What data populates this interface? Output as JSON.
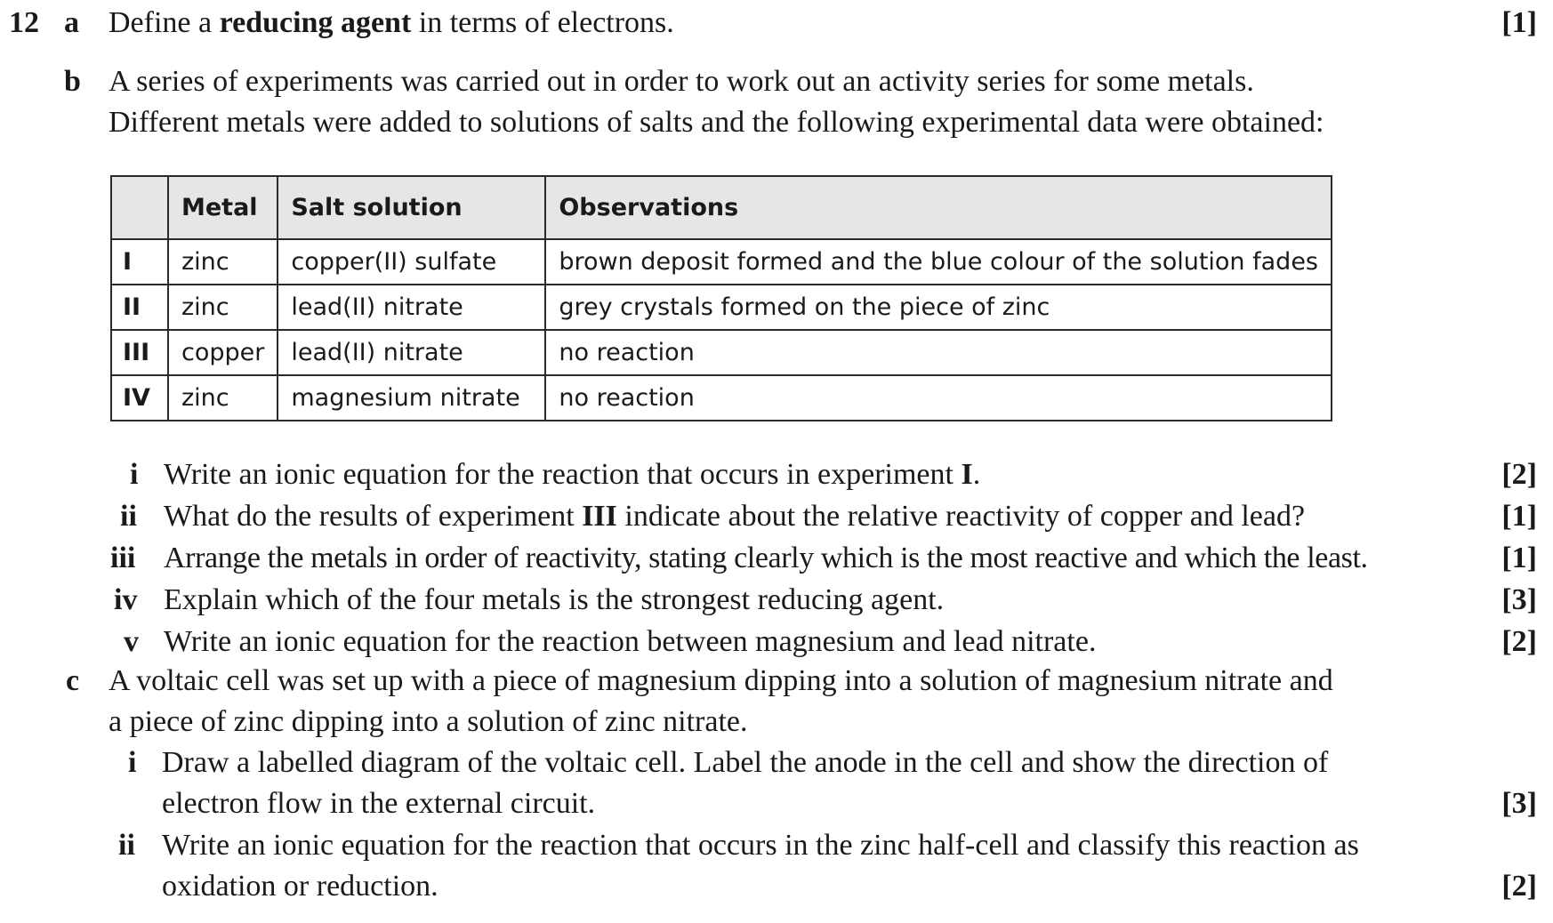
{
  "question": {
    "number": "12",
    "a": {
      "letter": "a",
      "text_before": "Define a ",
      "text_bold": "reducing agent",
      "text_after": " in terms of electrons.",
      "marks": "[1]"
    },
    "b": {
      "letter": "b",
      "intro_line1": "A series of experiments was carried out in order to work out an activity series for some metals.",
      "intro_line2": "Different metals were added to solutions of salts and the following experimental data were obtained:",
      "table": {
        "headers": [
          "",
          "Metal",
          "Salt solution",
          "Observations"
        ],
        "rows": [
          {
            "id": "I",
            "metal": "zinc",
            "salt": "copper(II) sulfate",
            "observation": "brown deposit formed and the blue colour of the solution fades"
          },
          {
            "id": "II",
            "metal": "zinc",
            "salt": "lead(II) nitrate",
            "observation": "grey crystals formed on the piece of zinc"
          },
          {
            "id": "III",
            "metal": "copper",
            "salt": "lead(II) nitrate",
            "observation": "no reaction"
          },
          {
            "id": "IV",
            "metal": "zinc",
            "salt": "magnesium nitrate",
            "observation": "no reaction"
          }
        ]
      },
      "parts": [
        {
          "num": "i",
          "text": "Write an ionic equation for the reaction that occurs in experiment ",
          "bold": "I",
          "after": ".",
          "marks": "[2]"
        },
        {
          "num": "ii",
          "text": "What do the results of experiment ",
          "bold": "III",
          "after": " indicate about the relative reactivity of copper and lead?",
          "marks": "[1]"
        },
        {
          "num": "iii",
          "text": "Arrange the metals in order of reactivity, stating clearly which is the most reactive and which the least.",
          "bold": "",
          "after": "",
          "marks": "[1]"
        },
        {
          "num": "iv",
          "text": "Explain which of the four metals is the strongest reducing agent.",
          "bold": "",
          "after": "",
          "marks": "[3]"
        },
        {
          "num": "v",
          "text": "Write an ionic equation for the reaction between magnesium and lead nitrate.",
          "bold": "",
          "after": "",
          "marks": "[2]"
        }
      ]
    },
    "c": {
      "letter": "c",
      "intro_line1": "A voltaic cell was set up with a piece of magnesium dipping into a solution of magnesium nitrate and",
      "intro_line2": "a piece of zinc dipping into a solution of zinc nitrate.",
      "parts": [
        {
          "num": "i",
          "line1": "Draw a labelled diagram of the voltaic cell. Label the anode in the cell and show the direction of",
          "line2": "electron flow in the external circuit.",
          "marks": "[3]"
        },
        {
          "num": "ii",
          "line1": "Write an ionic equation for the reaction that occurs in the zinc half-cell and classify this reaction as",
          "line2": "oxidation or reduction.",
          "marks": "[2]"
        }
      ]
    }
  }
}
